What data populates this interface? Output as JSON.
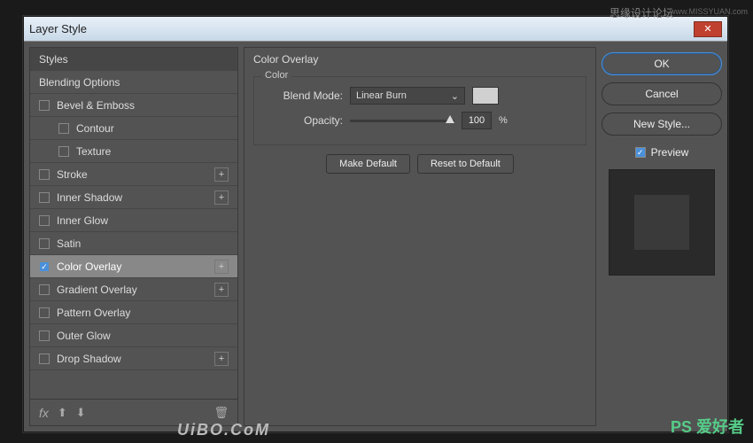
{
  "watermarks": {
    "top_cn": "思缘设计论坛",
    "top_url": "www.MISSYUAN.com",
    "bottom": "UiBO.CoM",
    "bottom_right": "PS 爱好者"
  },
  "dialog": {
    "title": "Layer Style",
    "close": "✕"
  },
  "left": {
    "styles_header": "Styles",
    "blending_options": "Blending Options",
    "items": [
      {
        "label": "Bevel & Emboss",
        "checked": false,
        "plus": false,
        "indent": false
      },
      {
        "label": "Contour",
        "checked": false,
        "plus": false,
        "indent": true
      },
      {
        "label": "Texture",
        "checked": false,
        "plus": false,
        "indent": true
      },
      {
        "label": "Stroke",
        "checked": false,
        "plus": true,
        "indent": false
      },
      {
        "label": "Inner Shadow",
        "checked": false,
        "plus": true,
        "indent": false
      },
      {
        "label": "Inner Glow",
        "checked": false,
        "plus": false,
        "indent": false
      },
      {
        "label": "Satin",
        "checked": false,
        "plus": false,
        "indent": false
      },
      {
        "label": "Color Overlay",
        "checked": true,
        "plus": true,
        "indent": false,
        "selected": true
      },
      {
        "label": "Gradient Overlay",
        "checked": false,
        "plus": true,
        "indent": false
      },
      {
        "label": "Pattern Overlay",
        "checked": false,
        "plus": false,
        "indent": false
      },
      {
        "label": "Outer Glow",
        "checked": false,
        "plus": false,
        "indent": false
      },
      {
        "label": "Drop Shadow",
        "checked": false,
        "plus": true,
        "indent": false
      }
    ],
    "footer_fx": "fx"
  },
  "center": {
    "title": "Color Overlay",
    "fieldset": "Color",
    "blend_mode_label": "Blend Mode:",
    "blend_mode_value": "Linear Burn",
    "opacity_label": "Opacity:",
    "opacity_value": "100",
    "percent": "%",
    "make_default": "Make Default",
    "reset_default": "Reset to Default",
    "swatch_color": "#d0d0d0"
  },
  "right": {
    "ok": "OK",
    "cancel": "Cancel",
    "new_style": "New Style...",
    "preview": "Preview"
  }
}
